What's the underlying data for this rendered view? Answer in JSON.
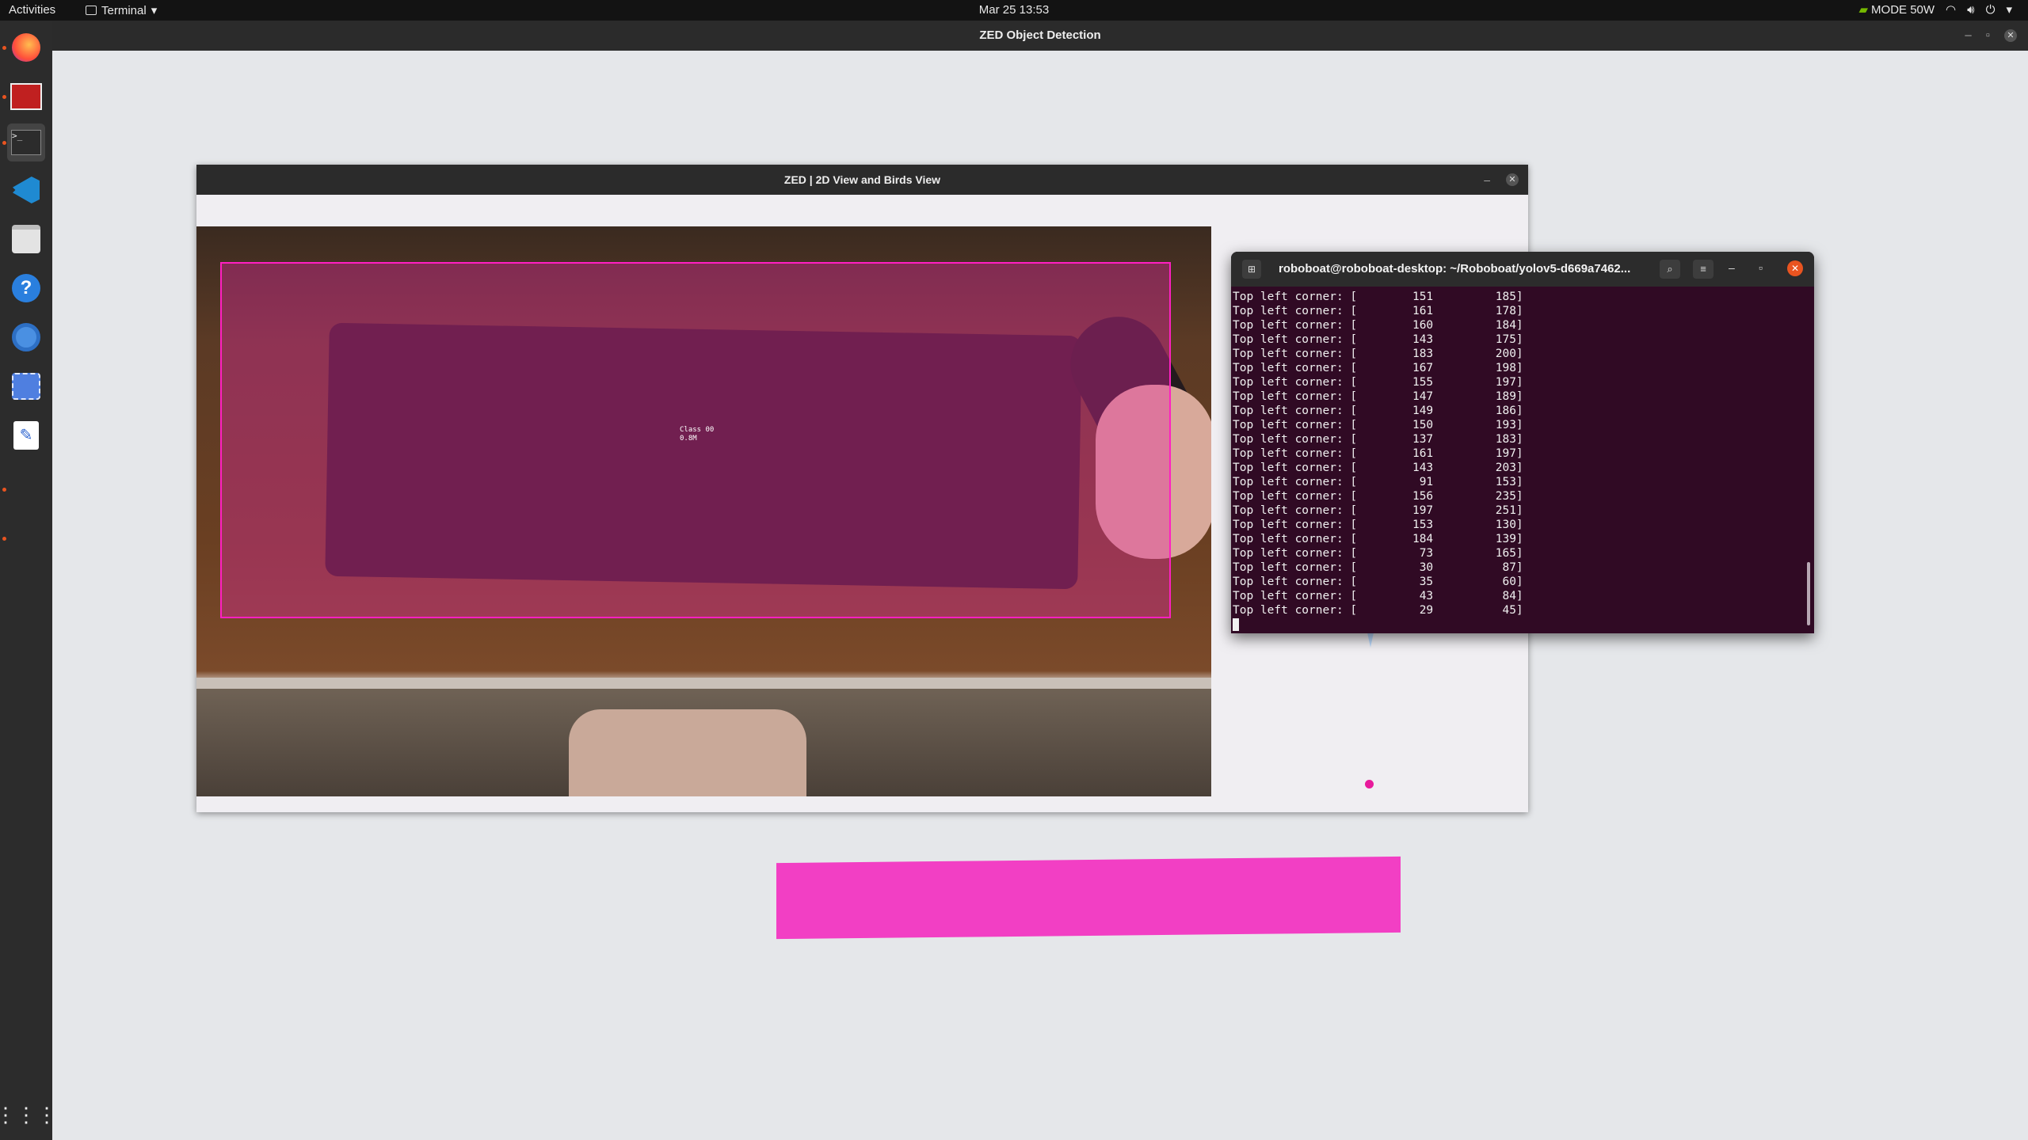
{
  "topbar": {
    "activities": "Activities",
    "app_name": "Terminal",
    "clock": "Mar 25  13:53",
    "power_mode": "MODE 50W"
  },
  "dock": {
    "items": [
      "firefox-icon",
      "zed-app-icon",
      "terminal-icon",
      "vscode-icon",
      "files-icon",
      "help-icon",
      "chromium-icon",
      "screenshot-icon",
      "text-editor-icon"
    ],
    "apps_grid": "show-applications-icon"
  },
  "main_window": {
    "title": "ZED Object Detection"
  },
  "zed2d_window": {
    "title": "ZED | 2D View and Birds View",
    "detection_label": "Class 00",
    "detection_distance": "0.8M"
  },
  "terminal": {
    "title": "roboboat@roboboat-desktop: ~/Roboboat/yolov5-d669a7462...",
    "lines": [
      "Top left corner: [        151         185]",
      "Top left corner: [        161         178]",
      "Top left corner: [        160         184]",
      "Top left corner: [        143         175]",
      "Top left corner: [        183         200]",
      "Top left corner: [        167         198]",
      "Top left corner: [        155         197]",
      "Top left corner: [        147         189]",
      "Top left corner: [        149         186]",
      "Top left corner: [        150         193]",
      "Top left corner: [        137         183]",
      "Top left corner: [        161         197]",
      "Top left corner: [        143         203]",
      "Top left corner: [         91         153]",
      "Top left corner: [        156         235]",
      "Top left corner: [        197         251]",
      "Top left corner: [        153         130]",
      "Top left corner: [        184         139]",
      "Top left corner: [         73         165]",
      "Top left corner: [         30          87]",
      "Top left corner: [         35          60]",
      "Top left corner: [         43          84]",
      "Top left corner: [         29          45]"
    ]
  },
  "colors": {
    "terminal_bg": "#300a24",
    "detection_box": "#ff1fc2",
    "dock_accent": "#e95420"
  }
}
